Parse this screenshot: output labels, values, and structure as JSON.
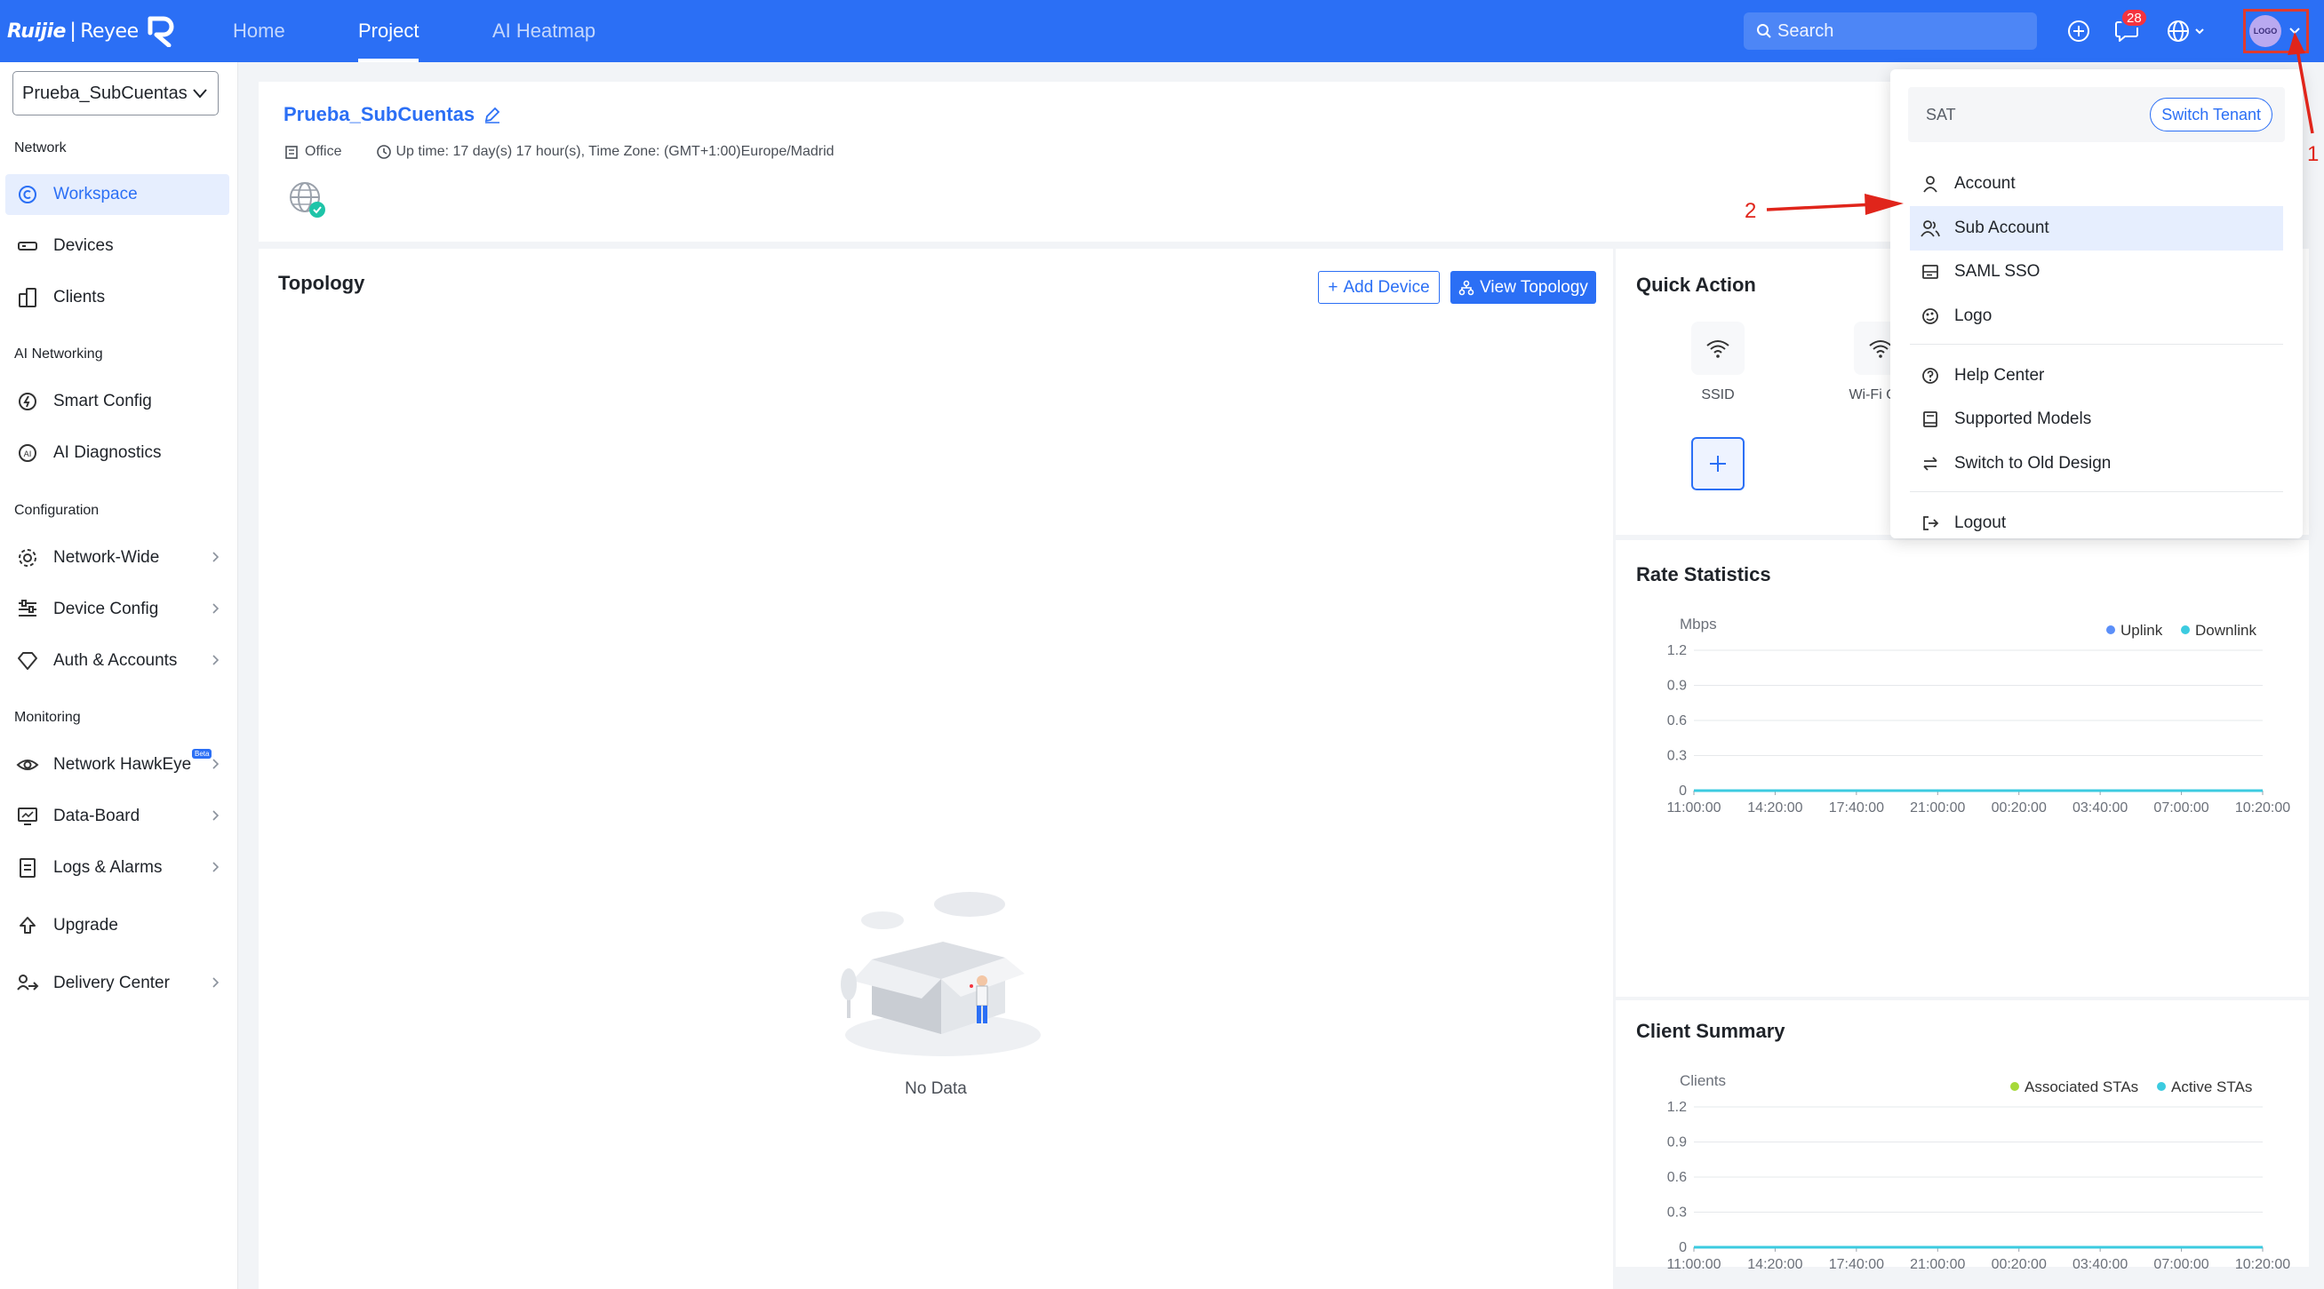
{
  "brand": {
    "name": "Ruijie",
    "separator": "|",
    "sub": "Reyee"
  },
  "nav": {
    "tabs": [
      {
        "label": "Home"
      },
      {
        "label": "Project"
      },
      {
        "label": "AI Heatmap"
      }
    ]
  },
  "search": {
    "placeholder": "Search"
  },
  "notifications": {
    "count": "28"
  },
  "avatar": {
    "text": "LOGO"
  },
  "sidebar": {
    "project": "Prueba_SubCuentas",
    "sections": {
      "network": "Network",
      "ai_networking": "AI Networking",
      "configuration": "Configuration",
      "monitoring": "Monitoring"
    },
    "items": {
      "workspace": "Workspace",
      "devices": "Devices",
      "clients": "Clients",
      "smart_config": "Smart Config",
      "ai_diagnostics": "AI Diagnostics",
      "network_wide": "Network-Wide",
      "device_config": "Device Config",
      "auth_accounts": "Auth & Accounts",
      "network_hawkeye": "Network HawkEye",
      "beta": "Beta",
      "data_board": "Data-Board",
      "logs_alarms": "Logs & Alarms",
      "upgrade": "Upgrade",
      "delivery_center": "Delivery Center"
    }
  },
  "header": {
    "project_title": "Prueba_SubCuentas",
    "scene": "Office",
    "uptime": "Up time: 17 day(s) 17 hour(s), Time Zone: (GMT+1:00)Europe/Madrid"
  },
  "topology": {
    "title": "Topology",
    "add_device": "Add Device",
    "view_topology": "View Topology",
    "empty": "No Data"
  },
  "quick_action": {
    "title": "Quick Action",
    "items": [
      {
        "label": "SSID"
      },
      {
        "label": "Wi-Fi Opti"
      }
    ]
  },
  "dropdown": {
    "tenant": "SAT",
    "switch_tenant": "Switch Tenant",
    "items": {
      "account": "Account",
      "sub_account": "Sub Account",
      "saml_sso": "SAML SSO",
      "logo": "Logo",
      "help_center": "Help Center",
      "supported_models": "Supported Models",
      "switch_old": "Switch to Old Design",
      "logout": "Logout"
    }
  },
  "annotations": {
    "one": "1",
    "two": "2"
  },
  "colors": {
    "primary": "#2b6ff5",
    "annotation": "#e0251b",
    "uplink": "#5b8ff9",
    "downlink": "#3ccbe0",
    "associated": "#a6d93a",
    "active": "#3ccbe0"
  },
  "chart_data": [
    {
      "type": "line",
      "title": "Rate Statistics",
      "ylabel": "Mbps",
      "x": [
        "11:00:00",
        "14:20:00",
        "17:40:00",
        "21:00:00",
        "00:20:00",
        "03:40:00",
        "07:00:00",
        "10:20:00"
      ],
      "yticks": [
        "1.2",
        "0.9",
        "0.6",
        "0.3",
        "0"
      ],
      "ylim": [
        0,
        1.2
      ],
      "series": [
        {
          "name": "Uplink",
          "values": [
            0,
            0,
            0,
            0,
            0,
            0,
            0,
            0
          ]
        },
        {
          "name": "Downlink",
          "values": [
            0,
            0,
            0,
            0,
            0,
            0,
            0,
            0
          ]
        }
      ],
      "legend": "top-right",
      "grid": true
    },
    {
      "type": "line",
      "title": "Client Summary",
      "ylabel": "Clients",
      "x": [
        "11:00:00",
        "14:20:00",
        "17:40:00",
        "21:00:00",
        "00:20:00",
        "03:40:00",
        "07:00:00",
        "10:20:00"
      ],
      "yticks": [
        "1.2",
        "0.9",
        "0.6",
        "0.3",
        "0"
      ],
      "ylim": [
        0,
        1.2
      ],
      "series": [
        {
          "name": "Associated STAs",
          "values": [
            0,
            0,
            0,
            0,
            0,
            0,
            0,
            0
          ]
        },
        {
          "name": "Active STAs",
          "values": [
            0,
            0,
            0,
            0,
            0,
            0,
            0,
            0
          ]
        }
      ],
      "legend": "top-right",
      "grid": true
    }
  ]
}
